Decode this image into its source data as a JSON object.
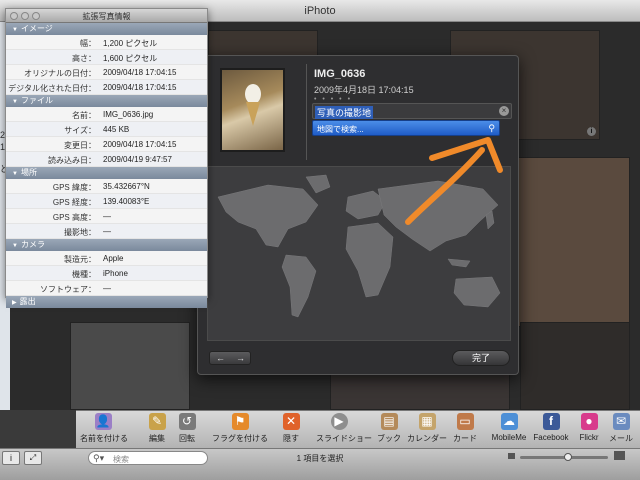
{
  "app": {
    "title": "iPhoto"
  },
  "info_panel": {
    "title": "拡張写真情報",
    "sections": [
      {
        "name": "イメージ",
        "rows": [
          {
            "label": "幅：",
            "value": "1,200 ピクセル"
          },
          {
            "label": "高さ：",
            "value": "1,600 ピクセル"
          },
          {
            "label": "オリジナルの日付：",
            "value": "2009/04/18 17:04:15"
          },
          {
            "label": "デジタル化された日付：",
            "value": "2009/04/18 17:04:15"
          }
        ]
      },
      {
        "name": "ファイル",
        "rows": [
          {
            "label": "名前：",
            "value": "IMG_0636.jpg"
          },
          {
            "label": "サイズ：",
            "value": "445 KB"
          },
          {
            "label": "変更日：",
            "value": "2009/04/18 17:04:15"
          },
          {
            "label": "読み込み日：",
            "value": "2009/04/19 9:47:57"
          }
        ]
      },
      {
        "name": "場所",
        "rows": [
          {
            "label": "GPS 緯度：",
            "value": "35.432667°N"
          },
          {
            "label": "GPS 経度：",
            "value": "139.40083°E"
          },
          {
            "label": "GPS 高度：",
            "value": "—"
          },
          {
            "label": "撮影地：",
            "value": "—"
          }
        ]
      },
      {
        "name": "カメラ",
        "rows": [
          {
            "label": "製造元：",
            "value": "Apple"
          },
          {
            "label": "機種：",
            "value": "iPhone"
          },
          {
            "label": "ソフトウェア：",
            "value": "—"
          }
        ]
      },
      {
        "name": "露出",
        "rows": []
      }
    ]
  },
  "popover": {
    "photo_name": "IMG_0636",
    "photo_datetime": "2009年4月18日 17:04:15",
    "rating_dots": "• • • • •",
    "place_field": "写真の撮影地",
    "map_search_placeholder": "地図で検索...",
    "nav_prev": "←",
    "nav_next": "→",
    "done_label": "完了"
  },
  "toolbar": {
    "items": [
      {
        "label": "名前を付ける",
        "icon": "name-icon",
        "color": "#9b7fc6"
      },
      {
        "label": "編集",
        "icon": "pencil-icon",
        "color": "#c9a24a"
      },
      {
        "label": "回転",
        "icon": "rotate-icon",
        "color": "#7a7a7a"
      },
      {
        "label": "フラグを付ける",
        "icon": "flag-icon",
        "color": "#e58a2b"
      },
      {
        "label": "隠す",
        "icon": "hide-x-icon",
        "color": "#e0622a"
      },
      {
        "label": "スライドショー",
        "icon": "play-icon",
        "color": "#8e8e8e"
      },
      {
        "label": "ブック",
        "icon": "book-icon",
        "color": "#b48a5a"
      },
      {
        "label": "カレンダー",
        "icon": "calendar-icon",
        "color": "#c4a46b"
      },
      {
        "label": "カード",
        "icon": "card-icon",
        "color": "#c07a4a"
      },
      {
        "label": "MobileMe",
        "icon": "cloud-icon",
        "color": "#4d8fd6"
      },
      {
        "label": "Facebook",
        "icon": "facebook-icon",
        "color": "#3b5998"
      },
      {
        "label": "Flickr",
        "icon": "flickr-icon",
        "color": "#d83b8c"
      },
      {
        "label": "メール",
        "icon": "mail-icon",
        "color": "#6a8bbf"
      }
    ]
  },
  "statusbar": {
    "info_button": "i",
    "fullscreen_button": "⤢",
    "search_placeholder": "検索",
    "selection_count": "1 項目を選択"
  },
  "source_list_fragments": [
    "2",
    "1",
    "ど"
  ]
}
